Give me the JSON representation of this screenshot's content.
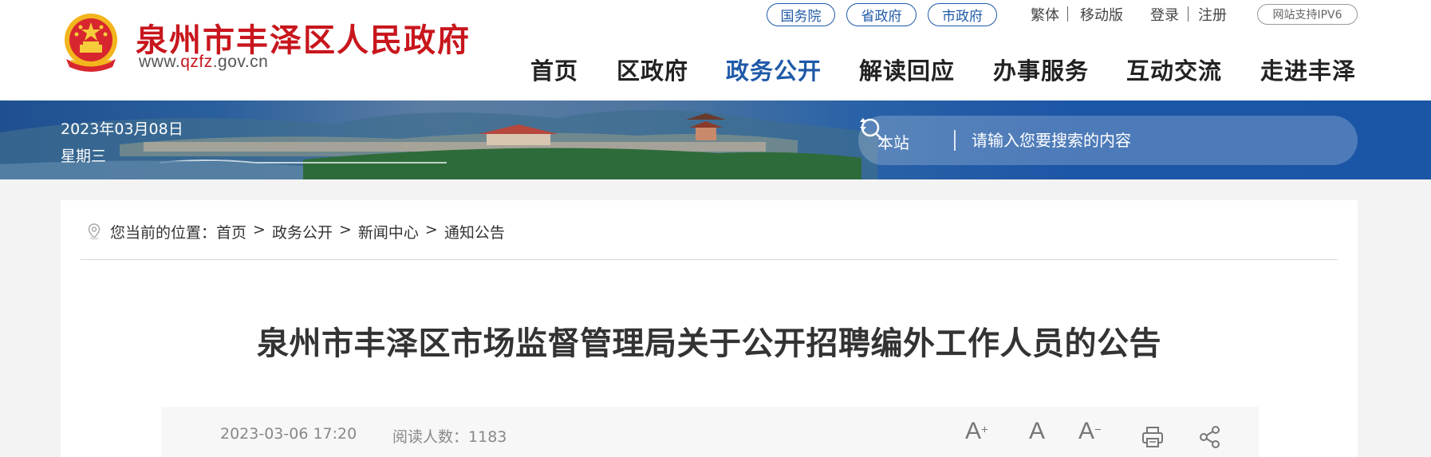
{
  "header": {
    "site_name": "泉州市丰泽区人民政府",
    "url_prefix": "www.",
    "url_highlight": "qzfz",
    "url_suffix": ".gov.cn",
    "top_links": [
      "国务院",
      "省政府",
      "市政府"
    ],
    "traditional": "繁体",
    "mobile": "移动版",
    "login": "登录",
    "register": "注册",
    "ipv6": "网站支持IPV6"
  },
  "nav": {
    "items": [
      "首页",
      "区政府",
      "政务公开",
      "解读回应",
      "办事服务",
      "互动交流",
      "走进丰泽"
    ],
    "active": "政务公开"
  },
  "banner": {
    "date": "2023年03月08日",
    "weekday": "星期三"
  },
  "search": {
    "scope": "本站",
    "placeholder": "请输入您要搜索的内容",
    "icon": "search-icon"
  },
  "breadcrumb": {
    "prefix": "您当前的位置：",
    "items": [
      "首页",
      "政务公开",
      "新闻中心",
      "通知公告"
    ],
    "separator": ">"
  },
  "article": {
    "title": "泉州市丰泽区市场监督管理局关于公开招聘编外工作人员的公告",
    "date": "2023-03-06 17:20",
    "read_label": "阅读人数：",
    "read_count": "1183"
  },
  "tools": {
    "font_larger": "A",
    "font_larger_mark": "+",
    "font_normal": "A",
    "font_smaller": "A",
    "font_smaller_mark": "−"
  },
  "colors": {
    "brand_red": "#c8161d",
    "brand_blue": "#1f5aa8",
    "banner_blue": "#1b55a6"
  }
}
